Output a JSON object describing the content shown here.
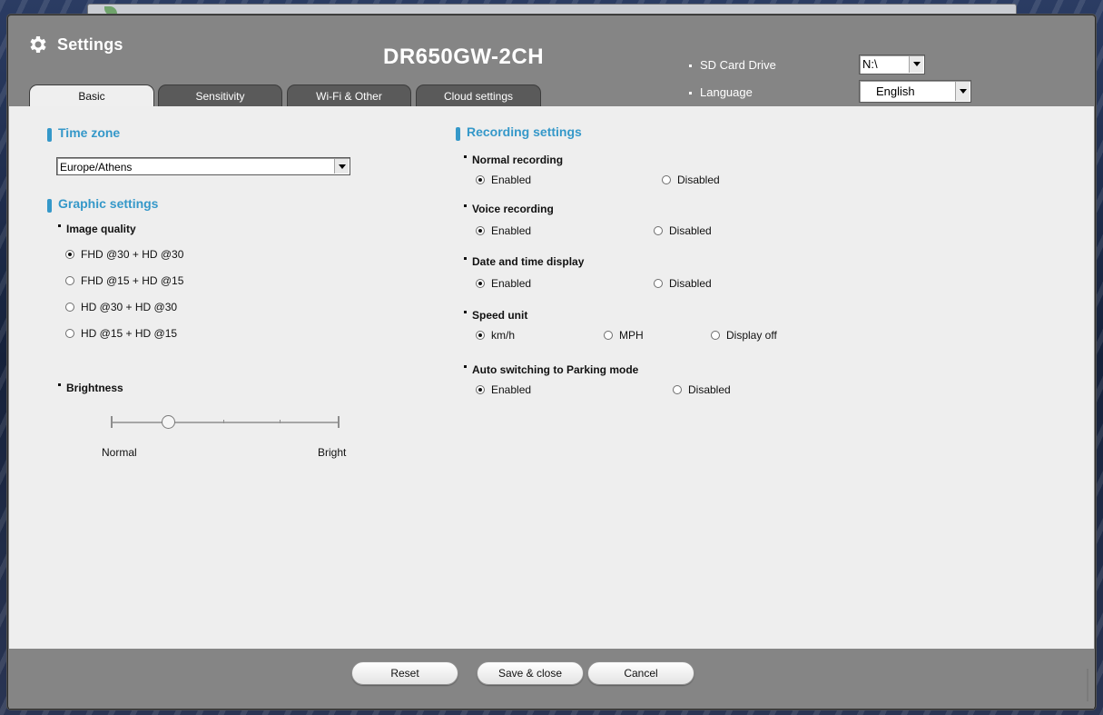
{
  "window": {
    "title": "Settings",
    "model": "DR650GW-2CH"
  },
  "header": {
    "sd_card_label": "SD Card Drive",
    "sd_card_value": "N:\\",
    "language_label": "Language",
    "language_value": "English"
  },
  "tabs": [
    {
      "label": "Basic",
      "active": true
    },
    {
      "label": "Sensitivity",
      "active": false
    },
    {
      "label": "Wi-Fi & Other",
      "active": false
    },
    {
      "label": "Cloud settings",
      "active": false
    }
  ],
  "time_zone": {
    "title": "Time zone",
    "value": "Europe/Athens"
  },
  "graphic": {
    "title": "Graphic settings",
    "image_quality_label": "Image quality",
    "options": [
      {
        "label": "FHD @30 + HD @30",
        "selected": true
      },
      {
        "label": "FHD @15 + HD @15",
        "selected": false
      },
      {
        "label": "HD @30 + HD @30",
        "selected": false
      },
      {
        "label": "HD @15 + HD @15",
        "selected": false
      }
    ],
    "brightness_label": "Brightness",
    "brightness_min_label": "Normal",
    "brightness_max_label": "Bright",
    "brightness_level": 0.25
  },
  "recording": {
    "title": "Recording settings",
    "groups": [
      {
        "label": "Normal recording",
        "options": [
          {
            "label": "Enabled",
            "selected": true
          },
          {
            "label": "Disabled",
            "selected": false
          }
        ]
      },
      {
        "label": "Voice recording",
        "options": [
          {
            "label": "Enabled",
            "selected": true
          },
          {
            "label": "Disabled",
            "selected": false
          }
        ]
      },
      {
        "label": "Date and time display",
        "options": [
          {
            "label": "Enabled",
            "selected": true
          },
          {
            "label": "Disabled",
            "selected": false
          }
        ]
      },
      {
        "label": "Speed unit",
        "options": [
          {
            "label": "km/h",
            "selected": true
          },
          {
            "label": "MPH",
            "selected": false
          },
          {
            "label": "Display off",
            "selected": false
          }
        ]
      },
      {
        "label": "Auto switching to Parking mode",
        "options": [
          {
            "label": "Enabled",
            "selected": true
          },
          {
            "label": "Disabled",
            "selected": false
          }
        ]
      }
    ]
  },
  "footer": {
    "reset_label": "Reset",
    "save_label": "Save & close",
    "cancel_label": "Cancel"
  },
  "colors": {
    "accent": "#3598c9",
    "frame": "#858585",
    "panel": "#eeeeee"
  }
}
